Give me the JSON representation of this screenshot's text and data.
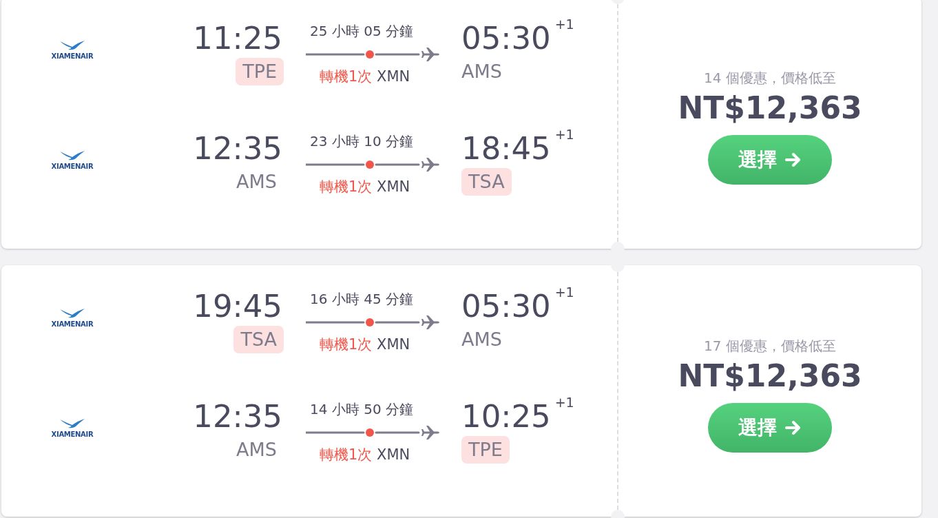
{
  "offers": [
    {
      "legs": [
        {
          "airline": "XIAMENAIR",
          "depart_time": "11:25",
          "depart_airport": {
            "code": "TPE",
            "highlighted": true
          },
          "duration": "25 小時 05 分鐘",
          "stops": "轉機1次",
          "via": "XMN",
          "arrive_time": "05:30",
          "day_offset": "+1",
          "arrive_airport": {
            "code": "AMS",
            "highlighted": false
          }
        },
        {
          "airline": "XIAMENAIR",
          "depart_time": "12:35",
          "depart_airport": {
            "code": "AMS",
            "highlighted": false
          },
          "duration": "23 小時 10 分鐘",
          "stops": "轉機1次",
          "via": "XMN",
          "arrive_time": "18:45",
          "day_offset": "+1",
          "arrive_airport": {
            "code": "TSA",
            "highlighted": true
          }
        }
      ],
      "deals": "14 個優惠，價格低至",
      "price": "NT$12,363",
      "button": "選擇"
    },
    {
      "legs": [
        {
          "airline": "XIAMENAIR",
          "depart_time": "19:45",
          "depart_airport": {
            "code": "TSA",
            "highlighted": true
          },
          "duration": "16 小時 45 分鐘",
          "stops": "轉機1次",
          "via": "XMN",
          "arrive_time": "05:30",
          "day_offset": "+1",
          "arrive_airport": {
            "code": "AMS",
            "highlighted": false
          }
        },
        {
          "airline": "XIAMENAIR",
          "depart_time": "12:35",
          "depart_airport": {
            "code": "AMS",
            "highlighted": false
          },
          "duration": "14 小時 50 分鐘",
          "stops": "轉機1次",
          "via": "XMN",
          "arrive_time": "10:25",
          "day_offset": "+1",
          "arrive_airport": {
            "code": "TPE",
            "highlighted": true
          }
        }
      ],
      "deals": "17 個優惠，價格低至",
      "price": "NT$12,363",
      "button": "選擇"
    }
  ]
}
